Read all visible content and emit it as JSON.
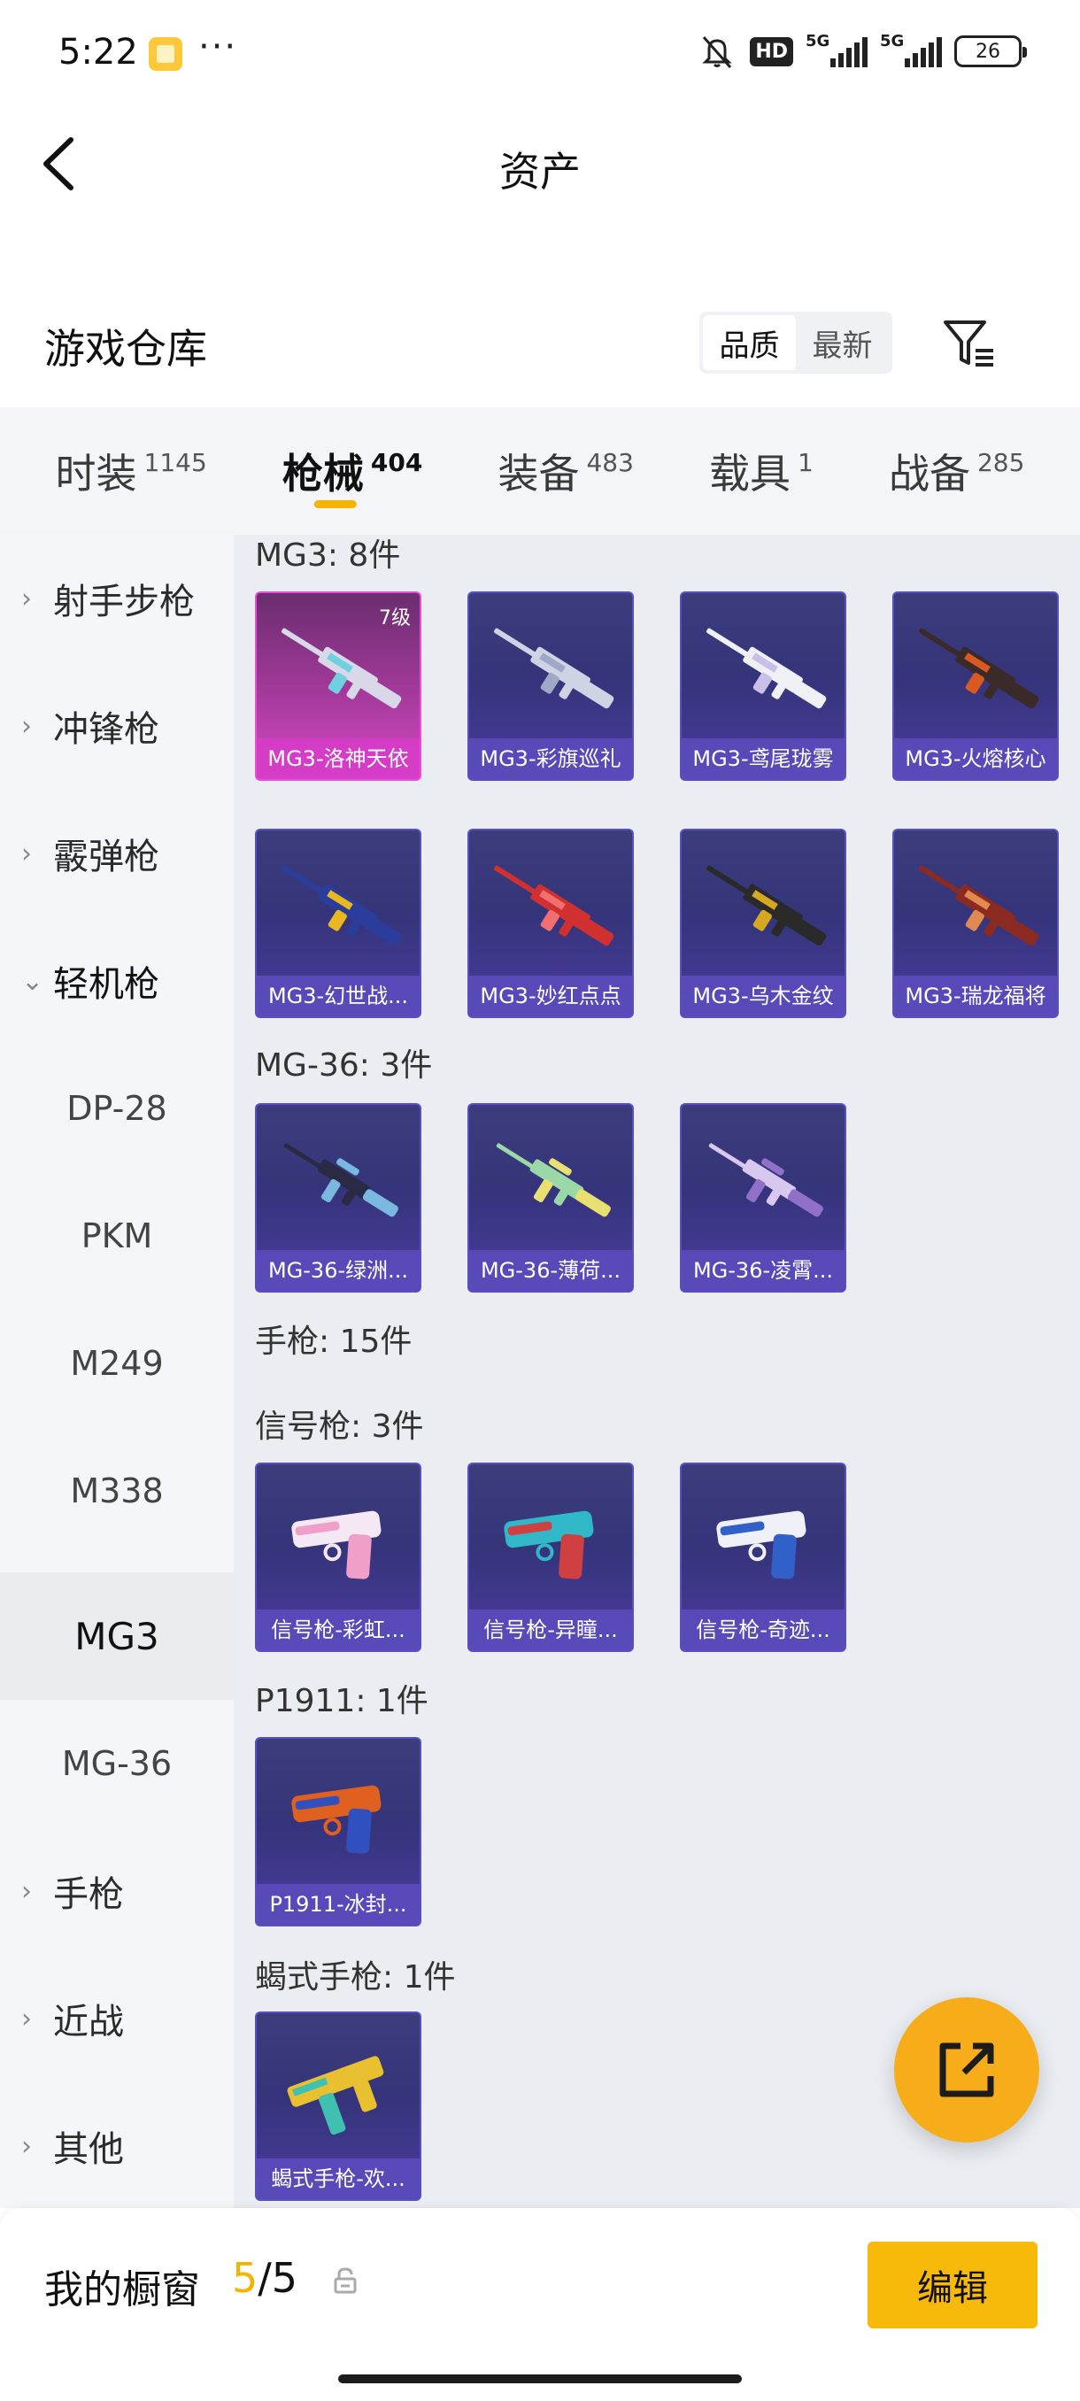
{
  "status_bar": {
    "time": "5:22",
    "more": "···",
    "hd": "HD",
    "net1": "5G",
    "net2": "5G",
    "battery": "26"
  },
  "header": {
    "title": "资产"
  },
  "warehouse": {
    "title": "游戏仓库",
    "sort_quality": "品质",
    "sort_latest": "最新"
  },
  "tabs": [
    {
      "label": "时装",
      "count": "1145"
    },
    {
      "label": "枪械",
      "count": "404"
    },
    {
      "label": "装备",
      "count": "483"
    },
    {
      "label": "载具",
      "count": "1"
    },
    {
      "label": "战备",
      "count": "285"
    }
  ],
  "sidebar": [
    {
      "label": "射手步枪"
    },
    {
      "label": "冲锋枪"
    },
    {
      "label": "霰弹枪"
    },
    {
      "label": "轻机枪"
    },
    {
      "label": "DP-28"
    },
    {
      "label": "PKM"
    },
    {
      "label": "M249"
    },
    {
      "label": "M338"
    },
    {
      "label": "MG3"
    },
    {
      "label": "MG-36"
    },
    {
      "label": "手枪"
    },
    {
      "label": "近战"
    },
    {
      "label": "其他"
    }
  ],
  "groups": {
    "mg3": {
      "title": "MG3: 8件"
    },
    "mg36": {
      "title": "MG-36: 3件"
    },
    "pistol": {
      "title": "手枪: 15件"
    },
    "flare": {
      "title": "信号枪: 3件"
    },
    "p1911": {
      "title": "P1911: 1件"
    },
    "scorpion": {
      "title": "蝎式手枪: 1件"
    }
  },
  "items": [
    {
      "name": "MG3-洛神天依",
      "level": "7级",
      "color": "#d8d8e8",
      "accent": "#6fd0e0"
    },
    {
      "name": "MG3-彩旗巡礼",
      "color": "#cfd4e4",
      "accent": "#a0a8c8"
    },
    {
      "name": "MG3-鸢尾珑雾",
      "color": "#eef0f4",
      "accent": "#c8c0e8"
    },
    {
      "name": "MG3-火熔核心",
      "color": "#3a2a2a",
      "accent": "#d85a20"
    },
    {
      "name": "MG3-幻世战...",
      "color": "#2b3d9a",
      "accent": "#e8b820"
    },
    {
      "name": "MG3-妙红点点",
      "color": "#d03030",
      "accent": "#f07070"
    },
    {
      "name": "MG3-乌木金纹",
      "color": "#2a2a2a",
      "accent": "#d4a820"
    },
    {
      "name": "MG3-瑞龙福将",
      "color": "#8a2a20",
      "accent": "#e08a50"
    },
    {
      "name": "MG-36-绿洲...",
      "color": "#2a2a44",
      "accent": "#7ab8e0"
    },
    {
      "name": "MG-36-薄荷...",
      "color": "#9ad8a8",
      "accent": "#e8e070"
    },
    {
      "name": "MG-36-凌霄...",
      "color": "#d8c8f0",
      "accent": "#9070c8"
    },
    {
      "name": "信号枪-彩虹...",
      "color": "#f4e8f4",
      "accent": "#f0a0c8"
    },
    {
      "name": "信号枪-异瞳...",
      "color": "#30b8c8",
      "accent": "#d04040"
    },
    {
      "name": "信号枪-奇迹...",
      "color": "#f0f0f8",
      "accent": "#3060c8"
    },
    {
      "name": "P1911-冰封...",
      "color": "#e06020",
      "accent": "#3050c0"
    },
    {
      "name": "蝎式手枪-欢...",
      "color": "#e8c030",
      "accent": "#40c0b0"
    }
  ],
  "bottom": {
    "label": "我的橱窗",
    "current": "5",
    "total": "/5",
    "edit": "编辑"
  },
  "colors": {
    "accent": "#f5b400",
    "card_bg": "#3a3a7c",
    "legend_bg": "#c844b8"
  }
}
